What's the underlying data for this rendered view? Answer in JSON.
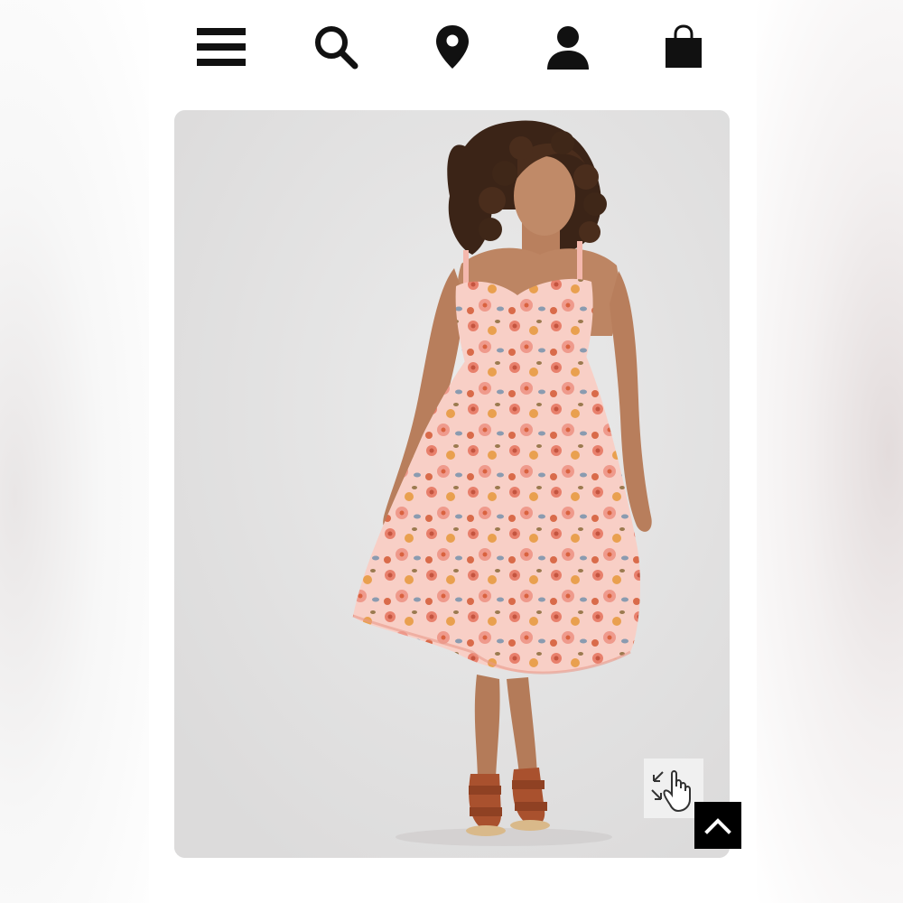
{
  "nav": {
    "icons": [
      "menu-icon",
      "search-icon",
      "location-pin-icon",
      "account-icon",
      "shopping-bag-icon"
    ]
  },
  "product_image": {
    "subject": "model-in-floral-midi-dress",
    "dress_colors": [
      "#f7c9be",
      "#e8806c",
      "#e59a48"
    ]
  },
  "overlays": {
    "zoom_hint_icon": "tap-to-zoom-icon",
    "back_to_top_icon": "chevron-up-icon"
  },
  "colors": {
    "icon": "#111111",
    "back_to_top_bg": "#000000"
  }
}
